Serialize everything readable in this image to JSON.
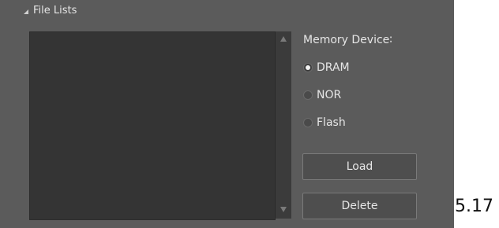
{
  "group": {
    "title": "File Lists"
  },
  "memory": {
    "label": "Memory Device∶",
    "options": [
      {
        "label": "DRAM",
        "checked": true
      },
      {
        "label": "NOR",
        "checked": false
      },
      {
        "label": "Flash",
        "checked": false
      }
    ]
  },
  "buttons": {
    "load": "Load",
    "delete": "Delete"
  },
  "side_text": "5.17",
  "icons": {
    "collapse": "collapse-triangle-icon",
    "scroll_up": "scroll-up-arrow-icon",
    "scroll_down": "scroll-down-arrow-icon"
  }
}
